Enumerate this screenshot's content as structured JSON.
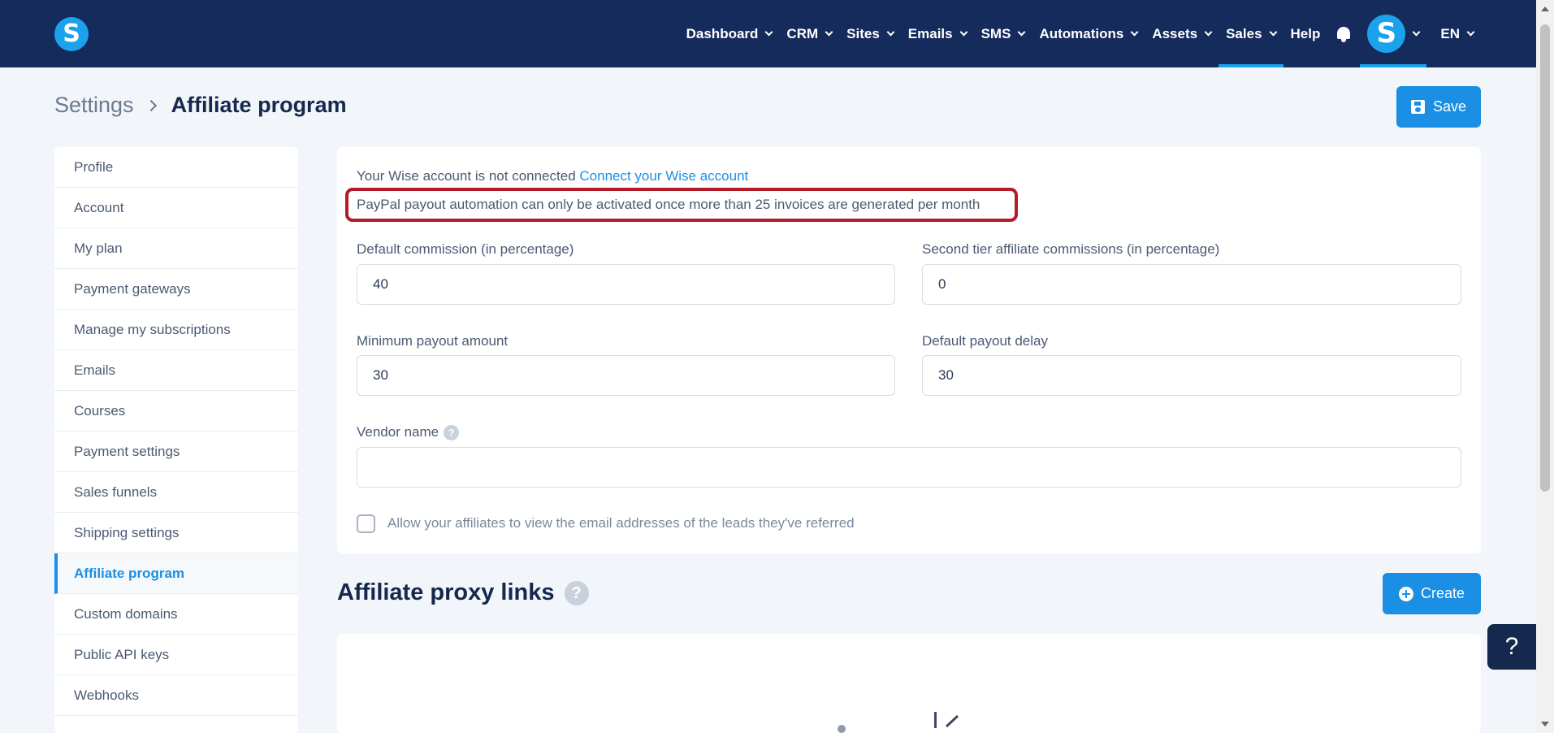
{
  "nav": {
    "items": [
      {
        "label": "Dashboard",
        "has_menu": true
      },
      {
        "label": "CRM",
        "has_menu": true
      },
      {
        "label": "Sites",
        "has_menu": true
      },
      {
        "label": "Emails",
        "has_menu": true
      },
      {
        "label": "SMS",
        "has_menu": true
      },
      {
        "label": "Automations",
        "has_menu": true
      },
      {
        "label": "Assets",
        "has_menu": true
      },
      {
        "label": "Sales",
        "has_menu": true,
        "active": true
      },
      {
        "label": "Help",
        "has_menu": false
      }
    ],
    "logo_letter": "S",
    "avatar_letter": "S",
    "language": "EN"
  },
  "header": {
    "breadcrumb_root": "Settings",
    "title": "Affiliate program",
    "save_label": "Save"
  },
  "sidebar": {
    "items": [
      {
        "label": "Profile"
      },
      {
        "label": "Account"
      },
      {
        "label": "My plan"
      },
      {
        "label": "Payment gateways"
      },
      {
        "label": "Manage my subscriptions"
      },
      {
        "label": "Emails"
      },
      {
        "label": "Courses"
      },
      {
        "label": "Payment settings"
      },
      {
        "label": "Sales funnels"
      },
      {
        "label": "Shipping settings"
      },
      {
        "label": "Affiliate program",
        "active": true
      },
      {
        "label": "Custom domains"
      },
      {
        "label": "Public API keys"
      },
      {
        "label": "Webhooks"
      }
    ]
  },
  "form": {
    "wise_status": "Your Wise account is not connected",
    "wise_link": "Connect your Wise account",
    "paypal_notice": "PayPal payout automation can only be activated once more than 25 invoices are generated per month",
    "default_commission": {
      "label": "Default commission (in percentage)",
      "value": "40"
    },
    "second_tier": {
      "label": "Second tier affiliate commissions (in percentage)",
      "value": "0"
    },
    "min_payout": {
      "label": "Minimum payout amount",
      "value": "30"
    },
    "payout_delay": {
      "label": "Default payout delay",
      "value": "30"
    },
    "vendor_name": {
      "label": "Vendor name",
      "value": ""
    },
    "allow_view_emails": {
      "label": "Allow your affiliates to view the email addresses of the leads they've referred",
      "checked": false
    }
  },
  "proxy_links": {
    "title": "Affiliate proxy links",
    "create_label": "Create"
  },
  "help_widget": {
    "label": "?"
  },
  "colors": {
    "nav_bg": "#152b5c",
    "accent": "#1a8fe3",
    "highlight_border": "#b31b28",
    "page_bg": "#f2f5f9"
  }
}
